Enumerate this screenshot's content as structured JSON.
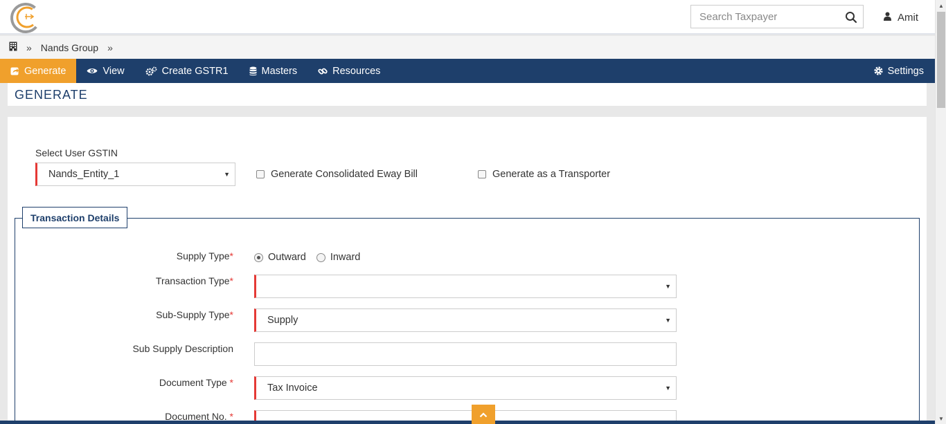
{
  "header": {
    "search_placeholder": "Search Taxpayer",
    "user_name": "Amit"
  },
  "breadcrumb": {
    "items": [
      "Nands Group"
    ]
  },
  "nav": {
    "items": [
      {
        "label": "Generate",
        "icon": "share-square-icon",
        "active": true
      },
      {
        "label": "View",
        "icon": "eye-icon"
      },
      {
        "label": "Create GSTR1",
        "icon": "gears-icon"
      },
      {
        "label": "Masters",
        "icon": "database-icon"
      },
      {
        "label": "Resources",
        "icon": "link-icon"
      }
    ],
    "settings_label": "Settings"
  },
  "page": {
    "title": "GENERATE"
  },
  "form": {
    "gstin_label": "Select User GSTIN",
    "gstin_value": "Nands_Entity_1",
    "consolidated_label": "Generate Consolidated Eway Bill",
    "transporter_label": "Generate as a Transporter",
    "section_title": "Transaction Details",
    "supply_type_label": "Supply Type",
    "supply_options": [
      "Outward",
      "Inward"
    ],
    "supply_selected": "Outward",
    "transaction_type_label": "Transaction Type",
    "transaction_type_value": "",
    "sub_supply_type_label": "Sub-Supply Type",
    "sub_supply_type_value": "Supply",
    "sub_supply_desc_label": "Sub Supply Description",
    "document_type_label": "Document Type",
    "document_type_value": "Tax Invoice",
    "document_no_label": "Document No.",
    "required_mark": "*"
  },
  "colors": {
    "navy": "#1e3f6b",
    "accent": "#f0a02c",
    "required": "#e53935"
  }
}
